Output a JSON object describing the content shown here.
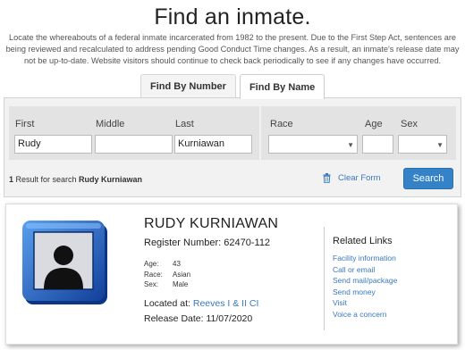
{
  "header": {
    "title": "Find an inmate.",
    "intro": "Locate the whereabouts of a federal inmate incarcerated from 1982 to the present. Due to the First Step Act, sentences are being reviewed and recalculated to address pending Good Conduct Time changes. As a result, an inmate's release date may not be up-to-date. Website visitors should continue to check back periodically to see if any changes have occurred."
  },
  "tabs": [
    {
      "label": "Find By Number",
      "active": false
    },
    {
      "label": "Find By Name",
      "active": true
    }
  ],
  "form": {
    "first_label": "First",
    "middle_label": "Middle",
    "last_label": "Last",
    "race_label": "Race",
    "age_label": "Age",
    "sex_label": "Sex",
    "first_value": "Rudy",
    "middle_value": "",
    "last_value": "Kurniawan",
    "race_value": "",
    "age_value": "",
    "sex_value": "",
    "result_count": "1",
    "result_text": " Result for search ",
    "result_query": "Rudy Kurniawan",
    "clear_label": "Clear Form",
    "search_label": "Search"
  },
  "result": {
    "name": "RUDY KURNIAWAN",
    "register_label": "Register Number: ",
    "register_number": "62470-112",
    "age_label": "Age:",
    "age": "43",
    "race_label": "Race:",
    "race": "Asian",
    "sex_label": "Sex:",
    "sex": "Male",
    "located_label": "Located at: ",
    "located_value": "Reeves I & II CI",
    "release_label": "Release Date: ",
    "release_value": "11/07/2020"
  },
  "related": {
    "title": "Related Links",
    "links": [
      "Facility information",
      "Call or email",
      "Send mail/package",
      "Send money",
      "Visit",
      "Voice a concern"
    ]
  },
  "colors": {
    "accent": "#3483c9",
    "link": "#3a78bd",
    "photo_frame": "#1e63c4"
  },
  "icons": {
    "trash": "trash-icon",
    "photo": "person-silhouette-icon",
    "select_arrow": "chevron-down-icon"
  }
}
